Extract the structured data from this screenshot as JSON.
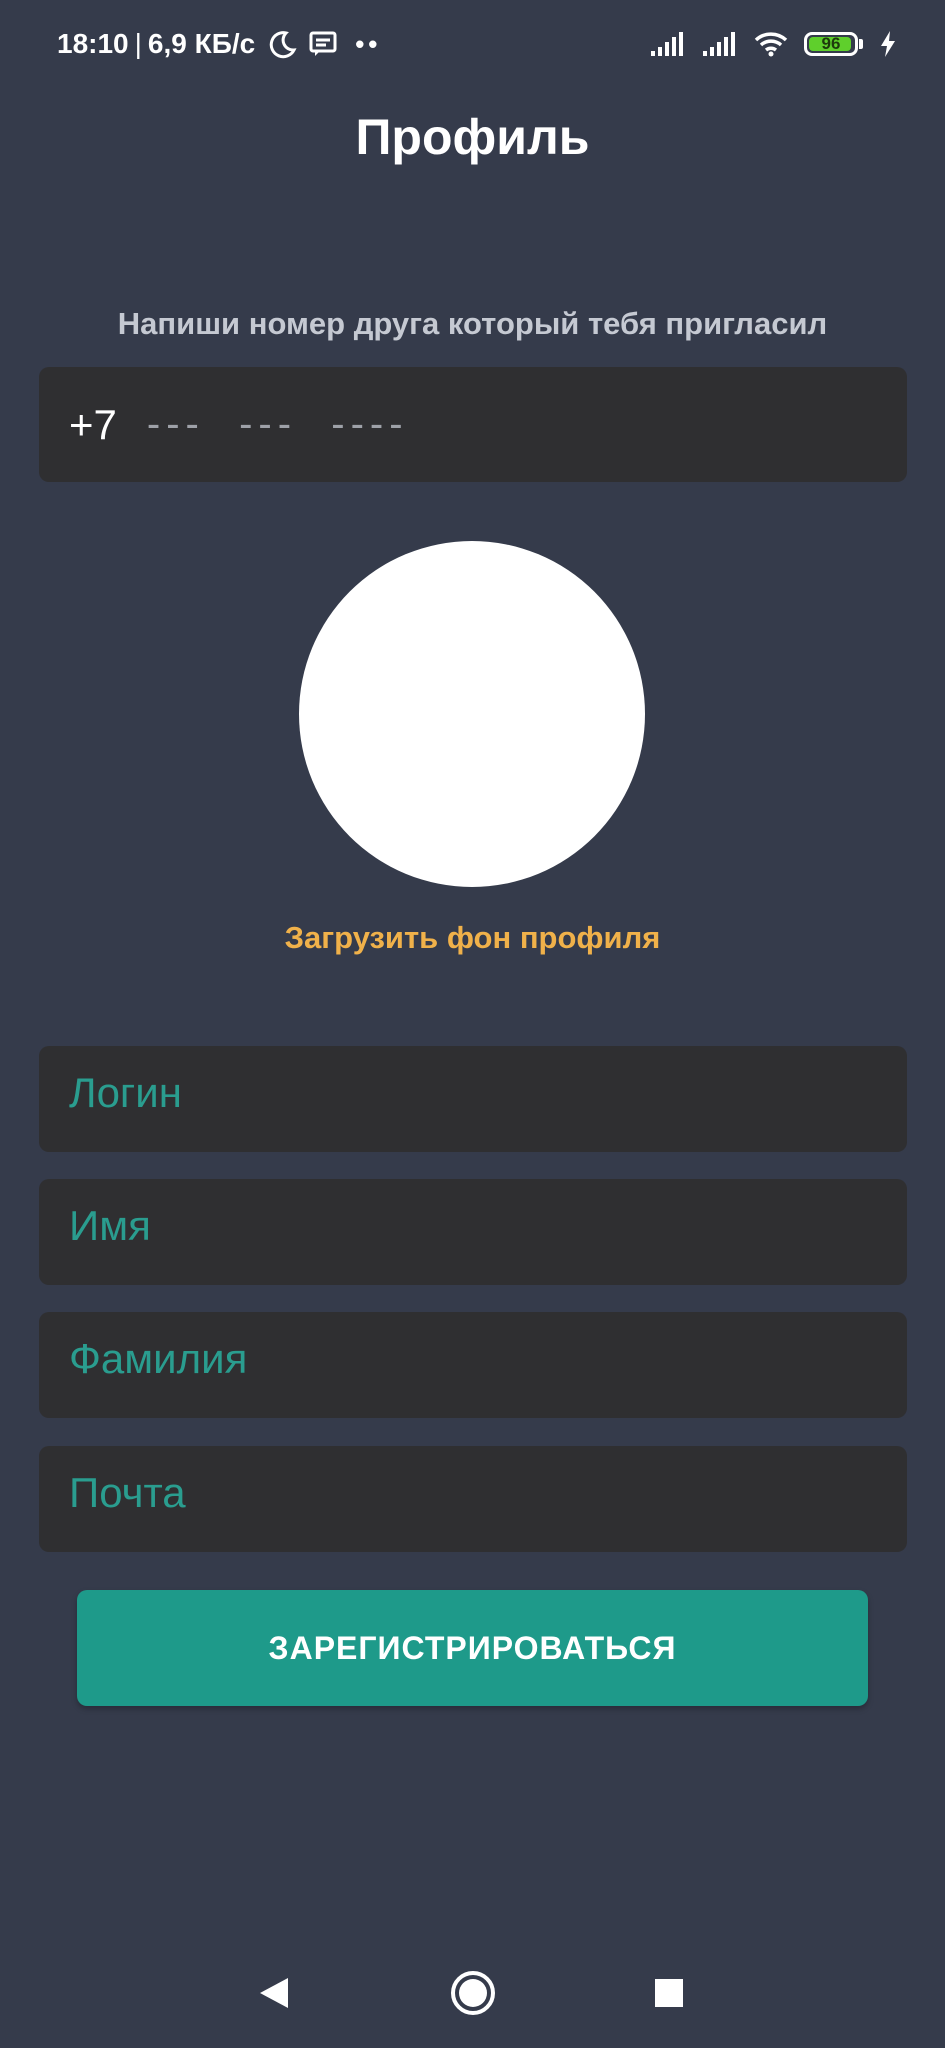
{
  "status_bar": {
    "time": "18:10",
    "separator": "|",
    "network_speed": "6,9 КБ/с",
    "battery_level": "96",
    "battery_fraction": 0.96,
    "icons": [
      "moon-icon",
      "message-icon",
      "more-dots-icon",
      "signal-icon",
      "signal-icon-2",
      "wifi-icon",
      "battery-icon",
      "charging-icon"
    ]
  },
  "header": {
    "title": "Профиль"
  },
  "invite": {
    "prompt": "Напиши номер друга который тебя пригласил",
    "phone_prefix": "+7",
    "phone_mask": "---  ---  ----"
  },
  "avatar": {
    "upload_background_label": "Загрузить фон профиля"
  },
  "form": {
    "login_placeholder": "Логин",
    "first_name_placeholder": "Имя",
    "last_name_placeholder": "Фамилия",
    "email_placeholder": "Почта",
    "submit_label": "ЗАРЕГИСТРИРОВАТЬСЯ"
  },
  "colors": {
    "background": "#353b4b",
    "field_background": "#2f2f31",
    "accent": "#1e9a8a",
    "placeholder": "#2a9d8f",
    "link": "#f0b14a"
  },
  "nav_bar": {
    "icons": [
      "back-icon",
      "home-icon",
      "recents-icon"
    ]
  }
}
